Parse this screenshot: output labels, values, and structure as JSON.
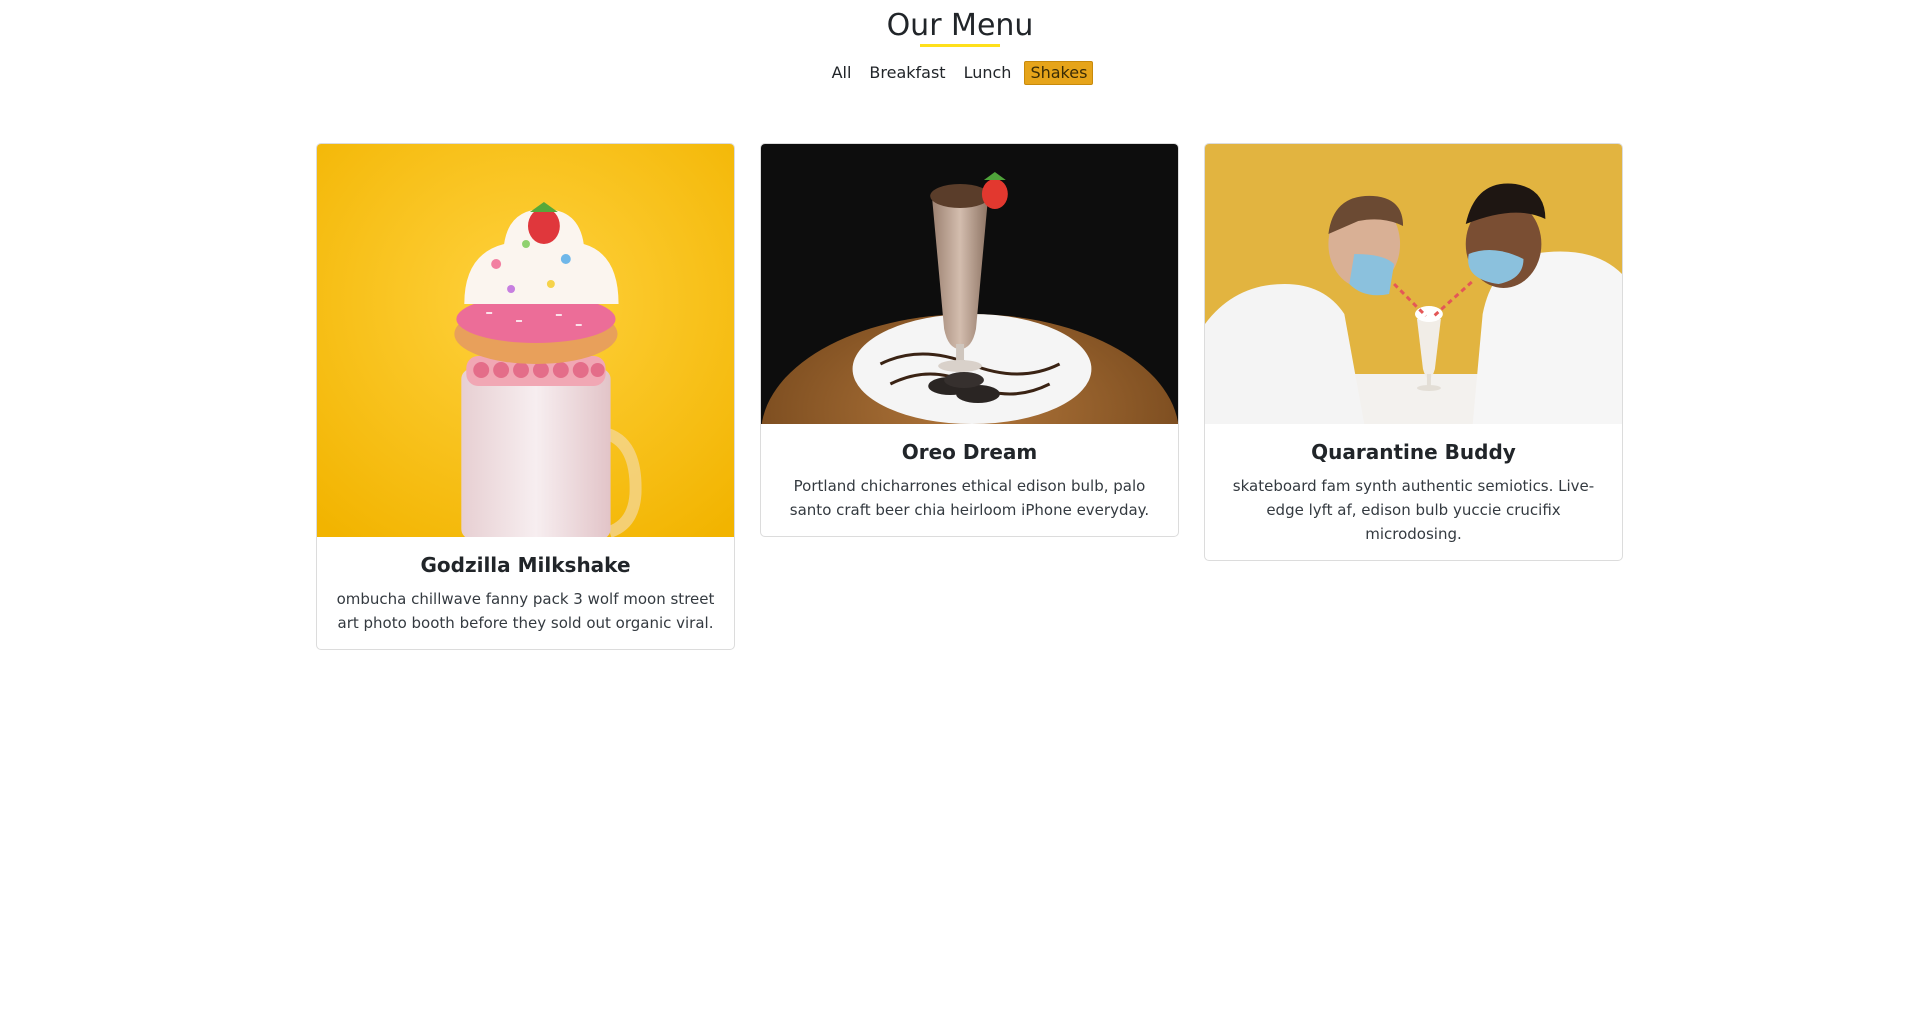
{
  "header": {
    "title": "Our Menu"
  },
  "filters": [
    {
      "label": "All",
      "active": false
    },
    {
      "label": "Breakfast",
      "active": false
    },
    {
      "label": "Lunch",
      "active": false
    },
    {
      "label": "Shakes",
      "active": true
    }
  ],
  "colors": {
    "accent_underline": "#ffe01b",
    "active_filter": "#e6a41a"
  },
  "items": [
    {
      "title": "Godzilla Milkshake",
      "description": "ombucha chillwave fanny pack 3 wolf moon street art photo booth before they sold out organic viral.",
      "image": "milkshake-with-donut-on-yellow-background"
    },
    {
      "title": "Oreo Dream",
      "description": "Portland chicharrones ethical edison bulb, palo santo craft beer chia heirloom iPhone everyday.",
      "image": "chocolate-shake-with-oreo-cookies"
    },
    {
      "title": "Quarantine Buddy",
      "description": "skateboard fam synth authentic semiotics. Live-edge lyft af, edison bulb yuccie crucifix microdosing.",
      "image": "two-people-with-masks-sharing-shake"
    }
  ]
}
